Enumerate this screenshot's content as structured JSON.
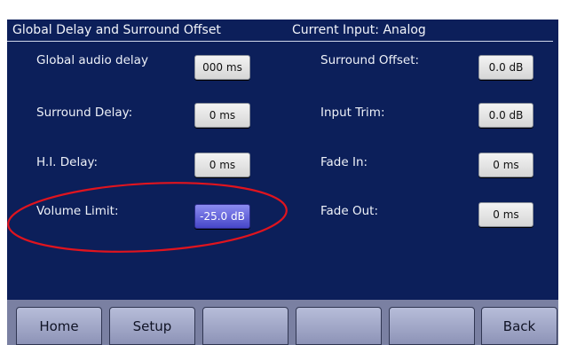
{
  "header": {
    "title": "Global Delay and Surround Offset",
    "input_status": "Current Input: Analog"
  },
  "left_fields": [
    {
      "label": "Global audio delay",
      "value": "000 ms"
    },
    {
      "label": "Surround Delay:",
      "value": "0 ms"
    },
    {
      "label": "H.I. Delay:",
      "value": "0 ms"
    },
    {
      "label": "Volume Limit:",
      "value": "-25.0 dB",
      "selected": true
    }
  ],
  "right_fields": [
    {
      "label": "Surround Offset:",
      "value": "0.0 dB"
    },
    {
      "label": "Input Trim:",
      "value": "0.0 dB"
    },
    {
      "label": "Fade In:",
      "value": "0 ms"
    },
    {
      "label": "Fade Out:",
      "value": "0 ms"
    }
  ],
  "nav": {
    "home": "Home",
    "setup": "Setup",
    "blank1": "",
    "blank2": "",
    "blank3": "",
    "back": "Back"
  },
  "colors": {
    "screen_bg": "#0c1f5a",
    "selected_value": "#5a5ad8",
    "annotation": "#e0141e"
  }
}
